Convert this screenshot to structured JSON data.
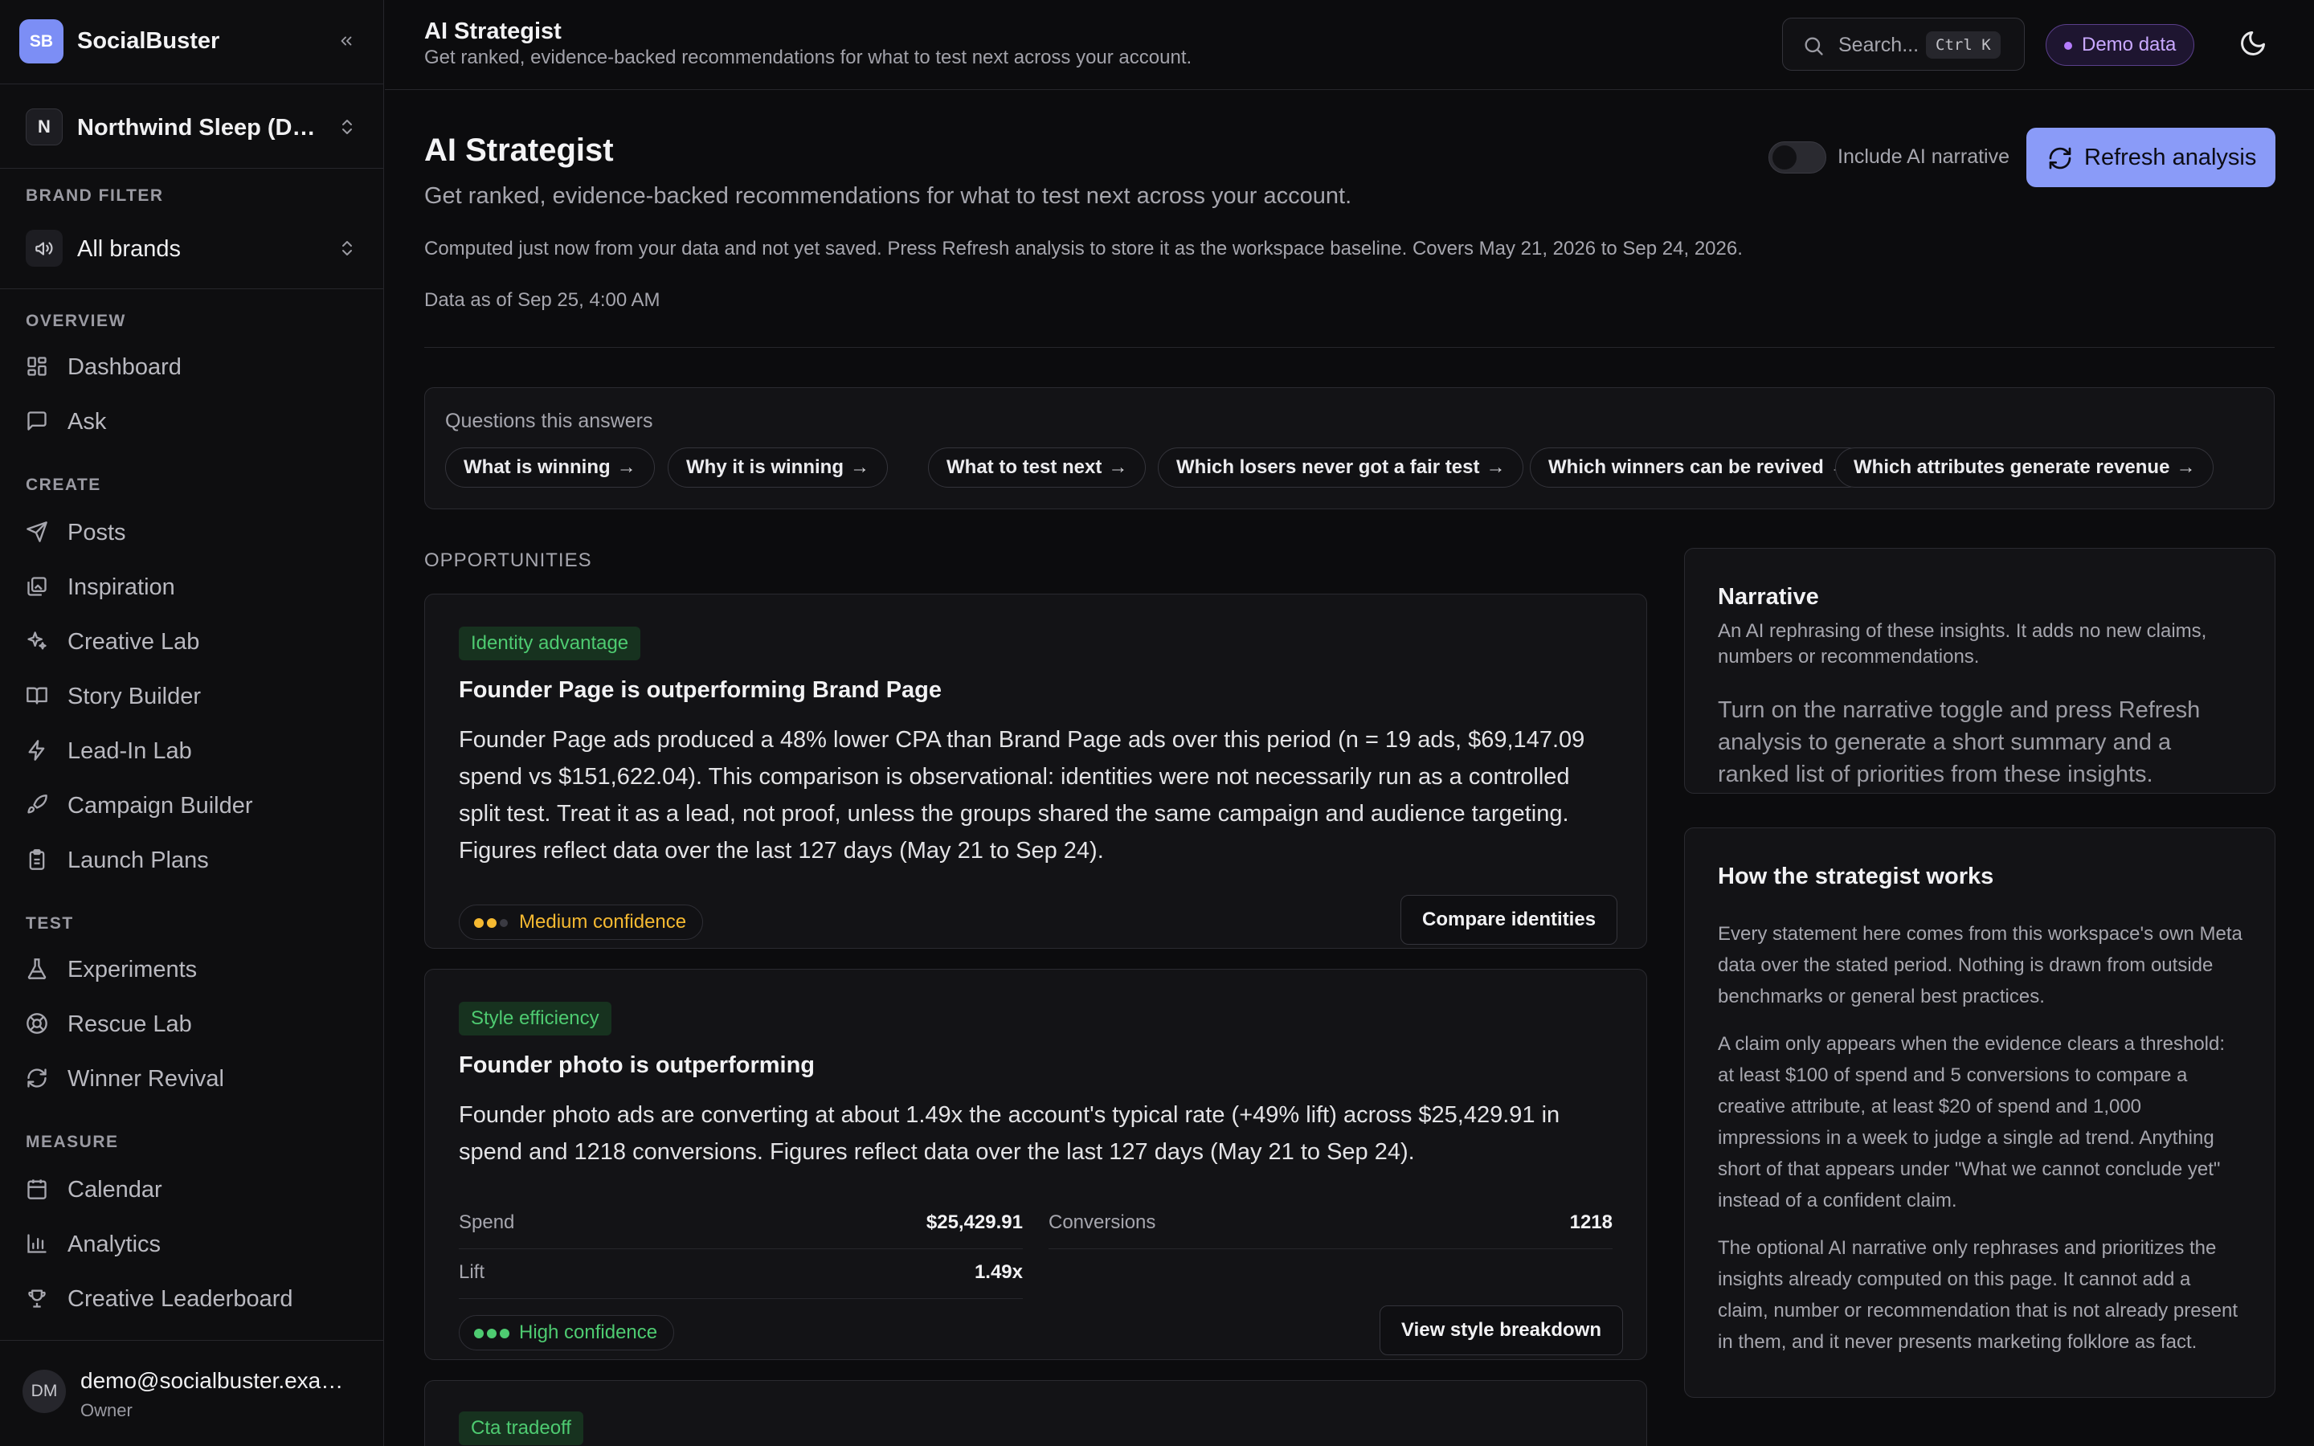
{
  "app": {
    "logo": "SB",
    "name": "SocialBuster"
  },
  "workspace": {
    "initial": "N",
    "name": "Northwind Sleep (Demo)"
  },
  "brand_filter": {
    "label": "BRAND FILTER",
    "value": "All brands"
  },
  "sidebar": {
    "sections": [
      {
        "label": "OVERVIEW",
        "items": [
          {
            "label": "Dashboard",
            "icon": "dashboard-icon"
          },
          {
            "label": "Ask",
            "icon": "chat-icon"
          }
        ]
      },
      {
        "label": "CREATE",
        "items": [
          {
            "label": "Posts",
            "icon": "send-icon"
          },
          {
            "label": "Inspiration",
            "icon": "image-icon"
          },
          {
            "label": "Creative Lab",
            "icon": "sparkles-icon"
          },
          {
            "label": "Story Builder",
            "icon": "book-icon"
          },
          {
            "label": "Lead-In Lab",
            "icon": "bolt-icon"
          },
          {
            "label": "Campaign Builder",
            "icon": "rocket-icon"
          },
          {
            "label": "Launch Plans",
            "icon": "clipboard-icon"
          }
        ]
      },
      {
        "label": "TEST",
        "items": [
          {
            "label": "Experiments",
            "icon": "flask-icon"
          },
          {
            "label": "Rescue Lab",
            "icon": "lifebuoy-icon"
          },
          {
            "label": "Winner Revival",
            "icon": "refresh-icon"
          }
        ]
      },
      {
        "label": "MEASURE",
        "items": [
          {
            "label": "Calendar",
            "icon": "calendar-icon"
          },
          {
            "label": "Analytics",
            "icon": "bar-chart-icon"
          },
          {
            "label": "Creative Leaderboard",
            "icon": "trophy-icon"
          }
        ]
      }
    ]
  },
  "user": {
    "initials": "DM",
    "email": "demo@socialbuster.example",
    "role": "Owner"
  },
  "topbar": {
    "title": "AI Strategist",
    "subtitle": "Get ranked, evidence-backed recommendations for what to test next across your account.",
    "search_placeholder": "Search...",
    "search_shortcut": "Ctrl K",
    "demo_badge": "Demo data"
  },
  "page": {
    "title": "AI Strategist",
    "subtitle": "Get ranked, evidence-backed recommendations for what to test next across your account.",
    "computed_note": "Computed just now from your data and not yet saved. Press Refresh analysis to store it as the workspace baseline. Covers May 21, 2026 to Sep 24, 2026.",
    "data_as_of": "Data as of Sep 25, 4:00 AM",
    "narrative_toggle_label": "Include AI narrative",
    "narrative_toggle_on": false,
    "refresh_label": "Refresh analysis",
    "accent": "#8a9bf8"
  },
  "questions": {
    "title": "Questions this answers",
    "chips": [
      "What is winning",
      "Why it is winning",
      "What to test next",
      "Which losers never got a fair test",
      "Which winners can be revived",
      "Which attributes generate revenue"
    ]
  },
  "opportunities": {
    "label": "OPPORTUNITIES",
    "cards": [
      {
        "tag": "Identity advantage",
        "title": "Founder Page is outperforming Brand Page",
        "body": "Founder Page ads produced a 48% lower CPA than Brand Page ads over this period (n = 19 ads, $69,147.09 spend vs $151,622.04). This comparison is observational: identities were not necessarily run as a controlled split test. Treat it as a lead, not proof, unless the groups shared the same campaign and audience targeting. Figures reflect data over the last 127 days (May 21 to Sep 24).",
        "confidence": "Medium confidence",
        "confidence_level": 2,
        "confidence_color": "#f5b931",
        "action": "Compare identities"
      },
      {
        "tag": "Style efficiency",
        "title": "Founder photo is outperforming",
        "body": "Founder photo ads are converting at about 1.49x the account's typical rate (+49% lift) across $25,429.91 in spend and 1218 conversions. Figures reflect data over the last 127 days (May 21 to Sep 24).",
        "metrics": [
          {
            "label": "Spend",
            "value": "$25,429.91"
          },
          {
            "label": "Conversions",
            "value": "1218"
          },
          {
            "label": "Lift",
            "value": "1.49x"
          }
        ],
        "confidence": "High confidence",
        "confidence_level": 3,
        "confidence_color": "#4ecb71",
        "action": "View style breakdown"
      },
      {
        "tag": "Cta tradeoff"
      }
    ]
  },
  "narrative": {
    "title": "Narrative",
    "description": "An AI rephrasing of these insights. It adds no new claims, numbers or recommendations.",
    "empty_state": "Turn on the narrative toggle and press Refresh analysis to generate a short summary and a ranked list of priorities from these insights."
  },
  "how_it_works": {
    "title": "How the strategist works",
    "paragraphs": [
      "Every statement here comes from this workspace's own Meta data over the stated period. Nothing is drawn from outside benchmarks or general best practices.",
      "A claim only appears when the evidence clears a threshold: at least $100 of spend and 5 conversions to compare a creative attribute, at least $20 of spend and 1,000 impressions in a week to judge a single ad trend. Anything short of that appears under \"What we cannot conclude yet\" instead of a confident claim.",
      "The optional AI narrative only rephrases and prioritizes the insights already computed on this page. It cannot add a claim, number or recommendation that is not already present in them, and it never presents marketing folklore as fact."
    ]
  }
}
